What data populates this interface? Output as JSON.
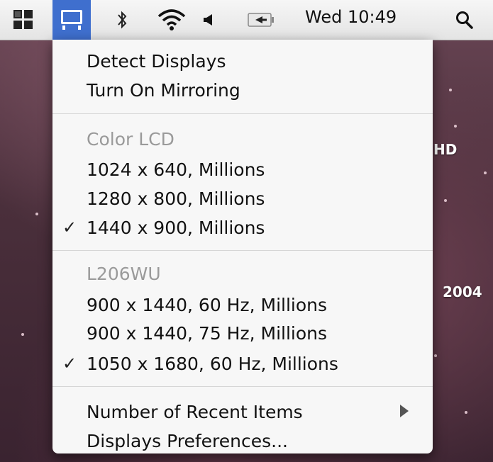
{
  "menubar": {
    "clock": "Wed 10:49",
    "icons": [
      "spaces-icon",
      "displays-icon",
      "bluetooth-icon",
      "wifi-icon",
      "volume-icon",
      "input-menu-icon",
      "spotlight-icon"
    ]
  },
  "desktop": {
    "labels": [
      "HD",
      "2004"
    ]
  },
  "menu": {
    "items": [
      {
        "label": "Detect Displays",
        "enabled": true,
        "checked": false
      },
      {
        "label": "Turn On Mirroring",
        "enabled": true,
        "checked": false
      },
      {
        "label": "Color LCD",
        "enabled": false,
        "checked": false
      },
      {
        "label": "1024 x 640, Millions",
        "enabled": true,
        "checked": false
      },
      {
        "label": "1280 x 800, Millions",
        "enabled": true,
        "checked": false
      },
      {
        "label": "1440 x 900, Millions",
        "enabled": true,
        "checked": true
      },
      {
        "label": "L206WU",
        "enabled": false,
        "checked": false
      },
      {
        "label": "900 x 1440, 60 Hz, Millions",
        "enabled": true,
        "checked": false
      },
      {
        "label": "900 x 1440, 75 Hz, Millions",
        "enabled": true,
        "checked": false
      },
      {
        "label": "1050 x 1680, 60 Hz, Millions",
        "enabled": true,
        "checked": true
      },
      {
        "label": "Number of Recent Items",
        "enabled": true,
        "checked": false,
        "submenu": true
      },
      {
        "label": "Displays Preferences...",
        "enabled": true,
        "checked": false
      }
    ],
    "check_glyph": "✓"
  }
}
